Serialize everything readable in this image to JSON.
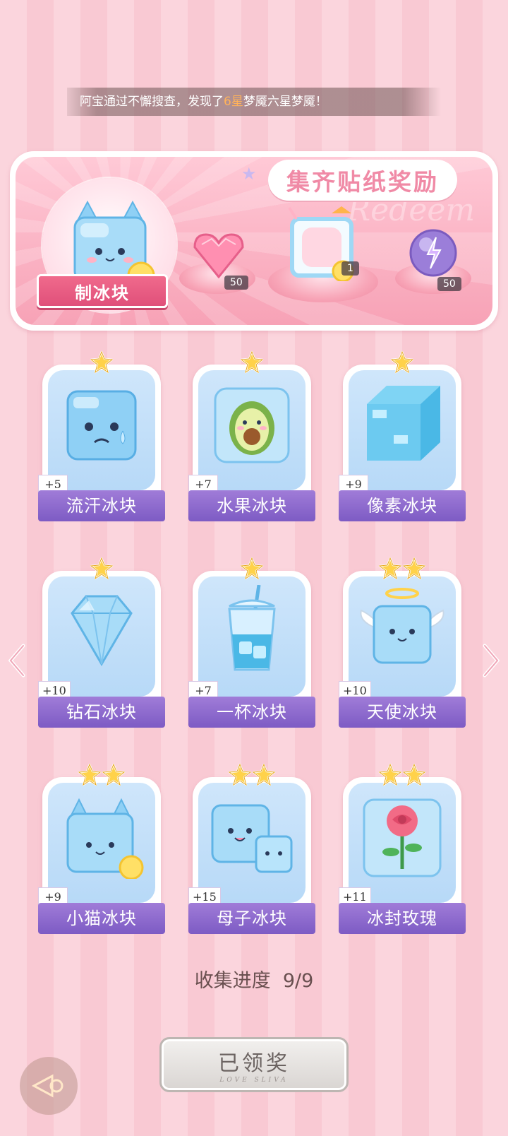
{
  "ticker": {
    "prefix": "阿宝通过不懈搜查，发现了",
    "highlight": "6星",
    "suffix": "梦魇六星梦魇！"
  },
  "reward": {
    "title": "集齐贴纸奖励",
    "watermark": "Redeem",
    "main_item_label": "制冰块",
    "items": [
      {
        "icon": "pink-diamond-icon",
        "count": "50"
      },
      {
        "icon": "lemon-drink-frame-icon",
        "count": "1"
      },
      {
        "icon": "purple-energy-orb-icon",
        "count": "50"
      }
    ]
  },
  "stickers": [
    {
      "name": "流汗冰块",
      "bonus": "+5",
      "stars": 1,
      "icon": "sweating-ice-cube-icon"
    },
    {
      "name": "水果冰块",
      "bonus": "+7",
      "stars": 1,
      "icon": "avocado-ice-cube-icon"
    },
    {
      "name": "像素冰块",
      "bonus": "+9",
      "stars": 1,
      "icon": "pixel-ice-cube-icon"
    },
    {
      "name": "钻石冰块",
      "bonus": "+10",
      "stars": 1,
      "icon": "diamond-ice-icon"
    },
    {
      "name": "一杯冰块",
      "bonus": "+7",
      "stars": 1,
      "icon": "cup-of-ice-icon"
    },
    {
      "name": "天使冰块",
      "bonus": "+10",
      "stars": 2,
      "icon": "angel-ice-cube-icon"
    },
    {
      "name": "小猫冰块",
      "bonus": "+9",
      "stars": 2,
      "icon": "cat-ice-cube-icon"
    },
    {
      "name": "母子冰块",
      "bonus": "+15",
      "stars": 2,
      "icon": "mother-child-ice-cube-icon"
    },
    {
      "name": "冰封玫瑰",
      "bonus": "+11",
      "stars": 2,
      "icon": "frozen-rose-icon"
    }
  ],
  "progress": {
    "label": "收集进度",
    "value": "9/9"
  },
  "claim_button": {
    "label": "已领奖",
    "subtext": "LOVE SLIVA"
  },
  "colors": {
    "accent_pink": "#f08aa6",
    "ribbon_purple": "#8a66cc",
    "ticker_highlight": "#ffb25a"
  }
}
